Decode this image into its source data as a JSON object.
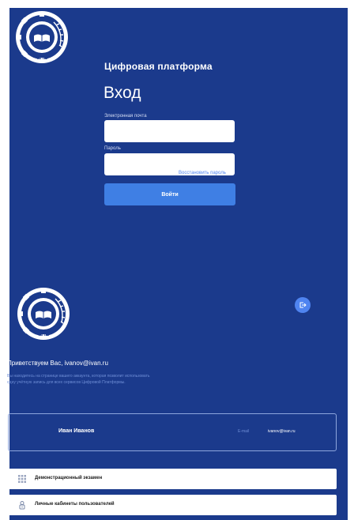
{
  "login": {
    "platform_title": "Цифровая платформа",
    "heading": "Вход",
    "email_label": "Электронная почта",
    "email_value": "",
    "password_label": "Пароль",
    "password_value": "",
    "forgot_link": "Восстановить пароль",
    "submit_label": "Войти"
  },
  "emblem": {
    "text": "МГПО"
  },
  "account": {
    "greeting": "Приветствуем Вас, ivanov@ivan.ru",
    "description": "Вы находитесь на странице вашего аккаунта, которая позволит использовать одну учётную запись для всех сервисов Цифровой Платформы.",
    "user_name": "Иван Иванов",
    "email_label": "E-mail",
    "email_value": "ivanov@ivan.ru"
  },
  "menu": [
    {
      "label": "Демонстрационный экзамен",
      "icon": "grid-icon"
    },
    {
      "label": "Личные кабинеты пользователей",
      "icon": "user-lock-icon"
    }
  ],
  "colors": {
    "primary_blue": "#1b3a8c",
    "accent_blue": "#3f7fe4",
    "link_blue": "#4f84f0",
    "white": "#ffffff"
  }
}
